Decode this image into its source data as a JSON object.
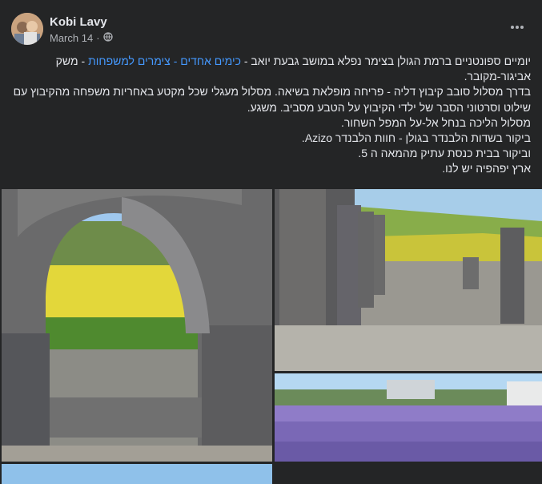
{
  "post": {
    "author": "Kobi Lavy",
    "date": "March 14",
    "separator": "·",
    "privacy_icon": "globe-icon",
    "more_icon": "more-horizontal-icon",
    "line1_start": "יומיים ספונטניים ברמת הגולן בצימר נפלא במושב גבעת יואב - ",
    "tag1": "כימים אחדים",
    "tag_sep": " - ",
    "tag2": "צימרים למשפחות",
    "line1_end": " - משק אביגור-מקובר.",
    "line2": "בדרך מסלול סובב קיבוץ דליה - פריחה מופלאת בשיאה. מסלול מעגלי שכל מקטע באחריות משפחה מהקיבוץ עם שילוט וסרטוני הסבר של ילדי הקיבוץ על הטבע מסביב. משגע.",
    "line3": "מסלול הליכה בנחל אל-על המפל השחור.",
    "line4": "ביקור בשדות הלבנדר בגולן - חוות הלבנדר Azizo.",
    "line5": "וביקור בבית כנסת עתיק מהמאה ה 5.",
    "line6": "ארץ יפהפיה יש לנו."
  },
  "photos": [
    "stone-arch-photo",
    "ancient-synagogue-columns-photo",
    "lavender-field-photo",
    "sky-photo-partial"
  ],
  "colors": {
    "background": "#242526",
    "text": "#e4e6eb",
    "secondary": "#b0b3b8",
    "link": "#4599ff"
  }
}
